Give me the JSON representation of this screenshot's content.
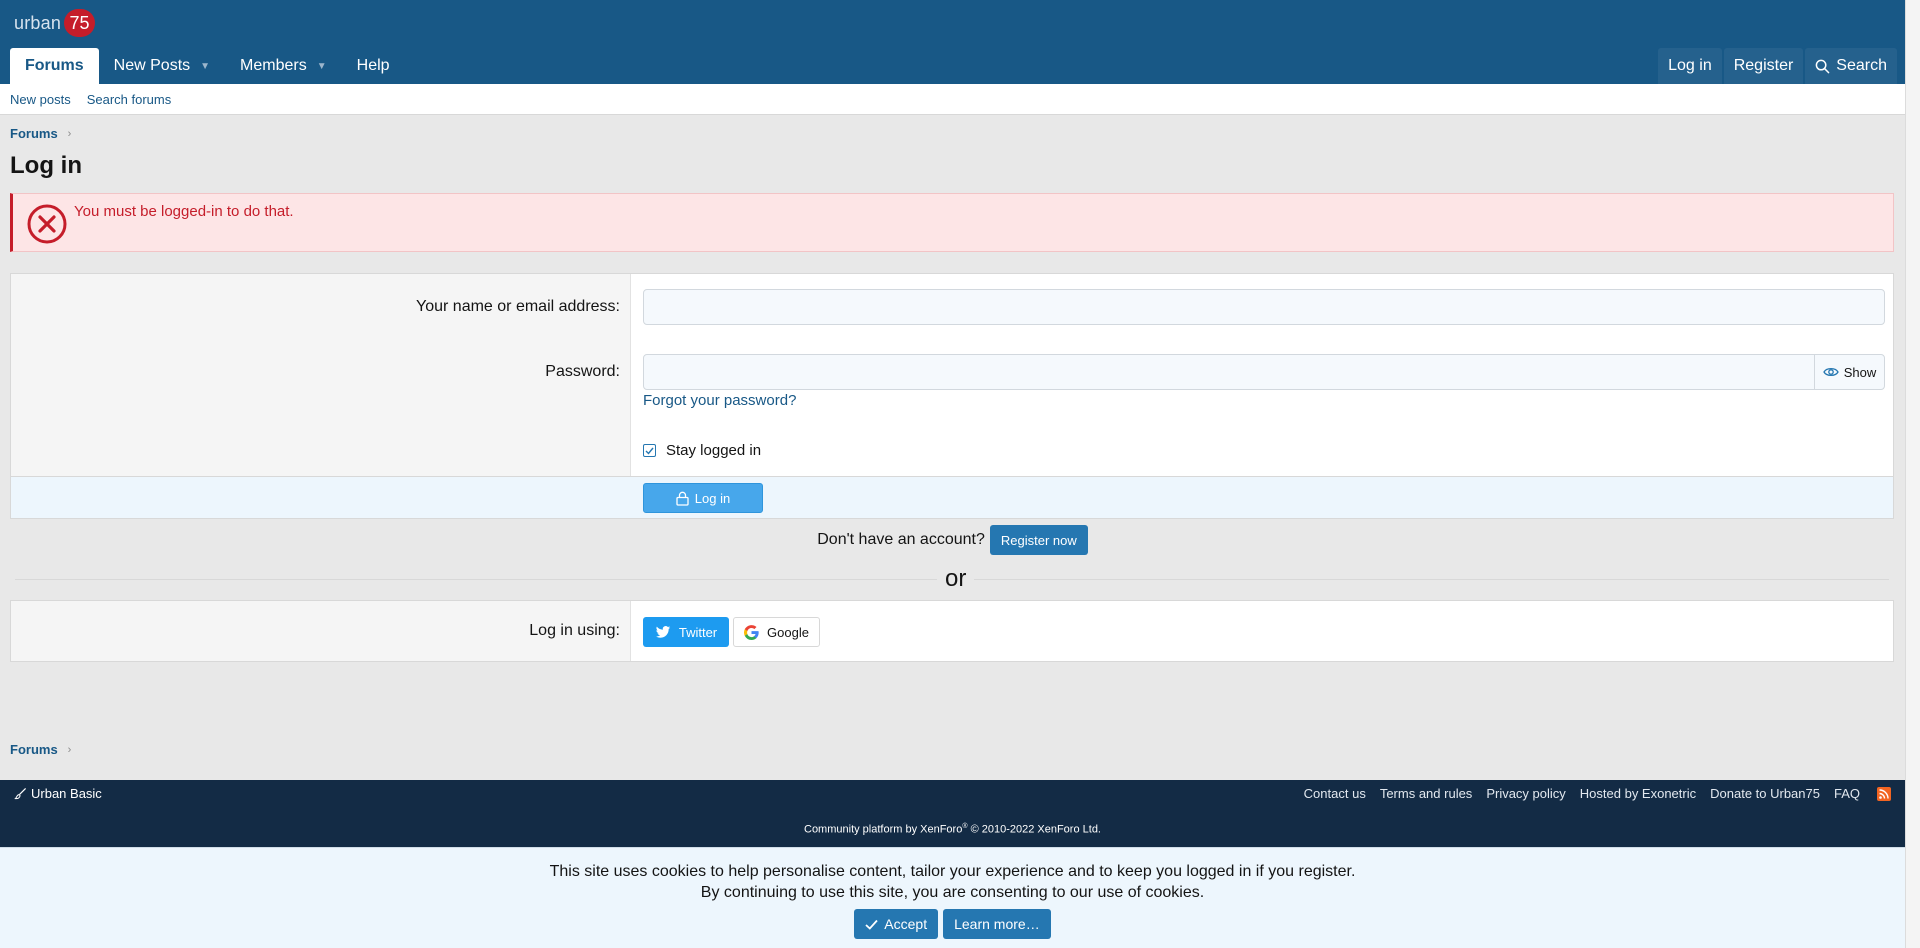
{
  "header": {
    "logo_text": "urban",
    "logo_badge": "75",
    "nav": [
      {
        "label": "Forums",
        "active": true
      },
      {
        "label": "New Posts",
        "dropdown": true
      },
      {
        "label": "Members",
        "dropdown": true
      },
      {
        "label": "Help"
      }
    ],
    "login_label": "Log in",
    "register_label": "Register",
    "search_label": "Search"
  },
  "subnav": {
    "new_posts": "New posts",
    "search_forums": "Search forums"
  },
  "breadcrumb": {
    "forums": "Forums"
  },
  "page_title": "Log in",
  "alert": {
    "message": "You must be logged-in to do that."
  },
  "login_form": {
    "name_label": "Your name or email address:",
    "name_value": "",
    "password_label": "Password:",
    "password_value": "",
    "show_label": "Show",
    "forgot_label": "Forgot your password?",
    "stay_logged_in_label": "Stay logged in",
    "stay_logged_in_checked": true,
    "submit_label": "Log in"
  },
  "register": {
    "prompt": "Don't have an account?",
    "button_label": "Register now"
  },
  "divider_text": "or",
  "social": {
    "label": "Log in using:",
    "twitter_label": "Twitter",
    "google_label": "Google"
  },
  "footer": {
    "style_label": "Urban Basic",
    "links": [
      "Contact us",
      "Terms and rules",
      "Privacy policy",
      "Hosted by Exonetric",
      "Donate to Urban75",
      "FAQ"
    ],
    "copyright_prefix": "Community platform by XenForo",
    "copyright_reg": "®",
    "copyright_suffix": " © 2010-2022 XenForo Ltd."
  },
  "cookie_notice": {
    "line1": "This site uses cookies to help personalise content, tailor your experience and to keep you logged in if you register.",
    "line2": "By continuing to use this site, you are consenting to our use of cookies.",
    "accept_label": "Accept",
    "learn_more_label": "Learn more…"
  },
  "colors": {
    "header": "#185886",
    "accent": "#2577b1",
    "error": "#c51d2a",
    "footer": "#132b45"
  }
}
